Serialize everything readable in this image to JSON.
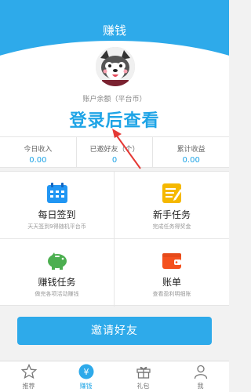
{
  "header": {
    "title": "赚钱"
  },
  "profile": {
    "balance_label": "账户余额（平台币）",
    "login_prompt": "登录后查看"
  },
  "stats": [
    {
      "label": "今日收入",
      "value": "0.00"
    },
    {
      "label": "已邀好友（个）",
      "value": "0"
    },
    {
      "label": "累计收益",
      "value": "0.00"
    }
  ],
  "features": [
    {
      "title": "每日签到",
      "subtitle": "天天签到9得随机平台币",
      "icon": "calendar-icon"
    },
    {
      "title": "新手任务",
      "subtitle": "完成任务得奖金",
      "icon": "notepad-icon"
    },
    {
      "title": "赚钱任务",
      "subtitle": "做完各项活动赚钱",
      "icon": "piggy-bank-icon"
    },
    {
      "title": "账单",
      "subtitle": "查看盈利明细账",
      "icon": "wallet-icon"
    }
  ],
  "invite_button": {
    "label": "邀请好友"
  },
  "tabbar": [
    {
      "label": "推荐",
      "icon": "star-icon"
    },
    {
      "label": "赚钱",
      "icon": "yen-icon",
      "active": true
    },
    {
      "label": "礼包",
      "icon": "gift-icon"
    },
    {
      "label": "我",
      "icon": "person-icon"
    }
  ],
  "colors": {
    "primary": "#2eaaea",
    "accent_text": "#1ea4e6",
    "annotation": "#e53935"
  }
}
